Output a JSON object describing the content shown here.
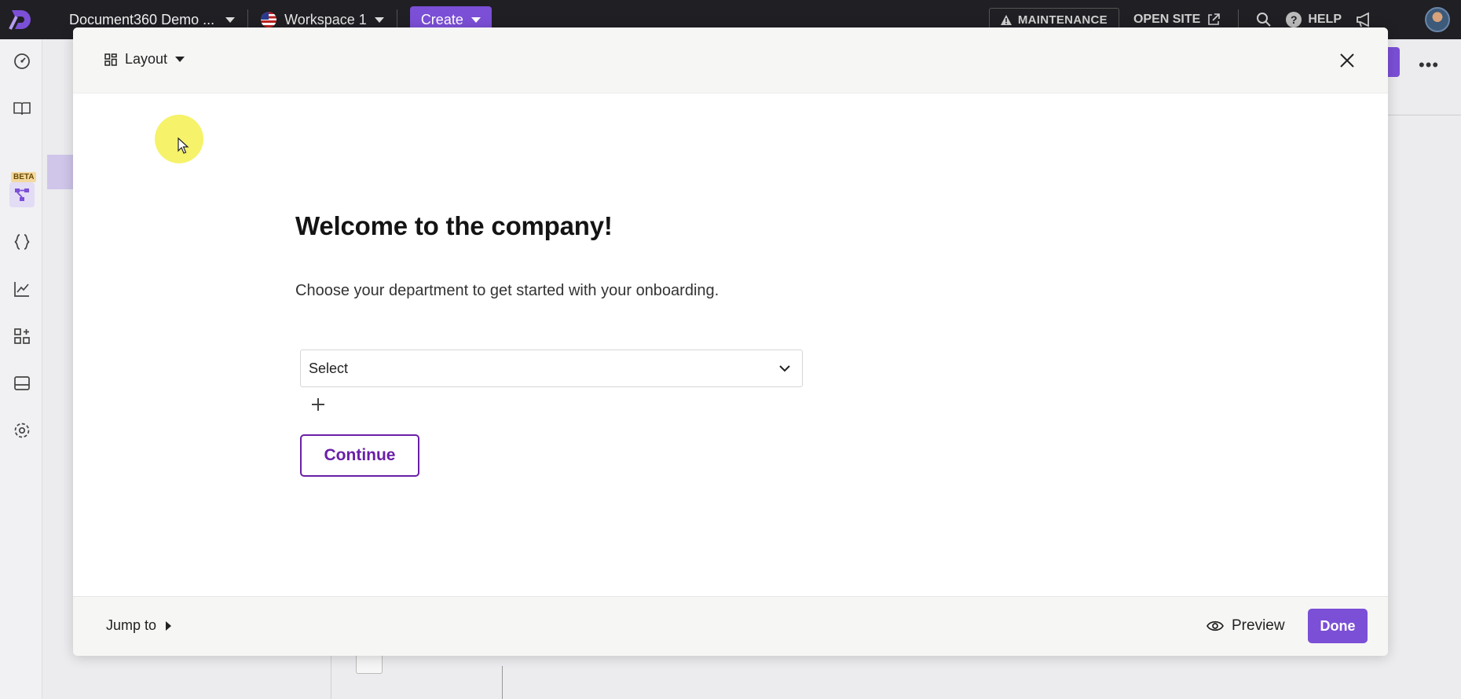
{
  "topbar": {
    "project_name": "Document360 Demo ...",
    "workspace": "Workspace 1",
    "create_label": "Create",
    "maintenance_label": "MAINTENANCE",
    "open_site_label": "OPEN SITE",
    "help_label": "HELP"
  },
  "rail": {
    "beta_badge": "BETA",
    "icons": [
      "dashboard-icon",
      "documentation-icon",
      "workflow-icon",
      "api-icon",
      "analytics-icon",
      "integrations-icon",
      "widget-icon",
      "settings-icon"
    ]
  },
  "modal": {
    "layout_label": "Layout",
    "title": "Welcome to the company!",
    "subtitle": "Choose your department to get started with your onboarding.",
    "select_value": "Select",
    "continue_label": "Continue",
    "jump_to_label": "Jump to",
    "preview_label": "Preview",
    "done_label": "Done"
  },
  "colors": {
    "accent": "#7b4fd6",
    "continue_border": "#6a1fa8",
    "topbar_bg": "#1f1f24"
  }
}
